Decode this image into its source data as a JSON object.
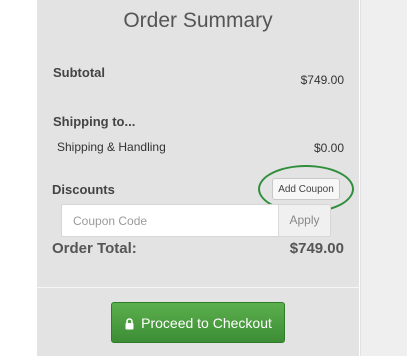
{
  "order_summary": {
    "title": "Order Summary",
    "subtotal_label": "Subtotal",
    "subtotal_value": "$749.00",
    "shipping_to_label": "Shipping to...",
    "shipping_handling_label": "Shipping & Handling",
    "shipping_handling_value": "$0.00",
    "discounts_label": "Discounts",
    "add_coupon_label": "Add Coupon",
    "coupon_placeholder": "Coupon Code",
    "apply_label": "Apply",
    "order_total_label": "Order Total:",
    "order_total_value": "$749.00",
    "checkout_label": "Proceed to Checkout",
    "checkout_icon": "lock-icon",
    "accent_color": "#4a9e40",
    "highlight_ring_color": "#2f8f3c"
  }
}
